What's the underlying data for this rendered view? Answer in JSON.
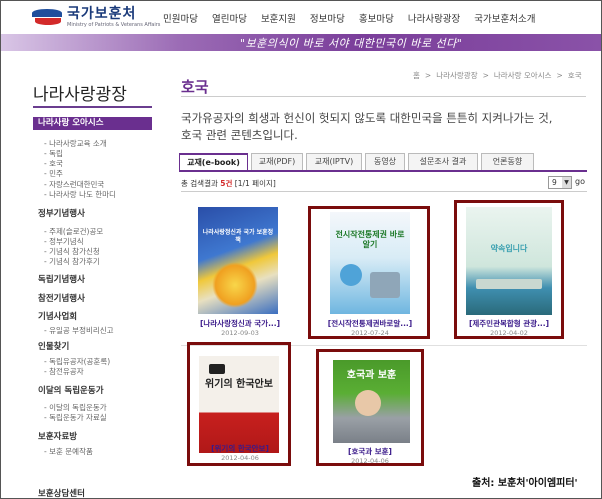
{
  "header": {
    "logo_ko": "국가보훈처",
    "logo_en": "Ministry of Patriots & Veterans Affairs",
    "nav": [
      "민원마당",
      "열린마당",
      "보훈지원",
      "정보마당",
      "홍보마당",
      "나라사랑광장",
      "국가보훈처소개"
    ],
    "slogan": "\"보훈의식이 바로 서야 대한민국이 바로 선다\""
  },
  "sidebar": {
    "title": "나라사랑광장",
    "active": "나라사랑 오아시스",
    "items": [
      {
        "label": "나라사랑교육 소개",
        "level": 2
      },
      {
        "label": "독립",
        "level": 2
      },
      {
        "label": "호국",
        "level": 2
      },
      {
        "label": "민주",
        "level": 2
      },
      {
        "label": "자랑스런대한민국",
        "level": 2
      },
      {
        "label": "나라사랑 나도 한마디",
        "level": 2
      },
      {
        "label": "정부기념행사",
        "level": 1
      },
      {
        "label": "주제(슬로건)공모",
        "level": 2
      },
      {
        "label": "정부기념식",
        "level": 2
      },
      {
        "label": "기념식 참가신청",
        "level": 2
      },
      {
        "label": "기념식 참가후기",
        "level": 2
      },
      {
        "label": "독립기념행사",
        "level": 1
      },
      {
        "label": "참전기념행사",
        "level": 1
      },
      {
        "label": "기념사업회",
        "level": 1
      },
      {
        "label": "유일공 부정비리신고",
        "level": 2
      },
      {
        "label": "인물찾기",
        "level": 1
      },
      {
        "label": "독립유공자(공훈록)",
        "level": 2
      },
      {
        "label": "참전유공자",
        "level": 2
      },
      {
        "label": "이달의 독립운동가",
        "level": 1
      },
      {
        "label": "이달의 독립운동가",
        "level": 2
      },
      {
        "label": "독립운동가 자료실",
        "level": 2
      },
      {
        "label": "보훈자료방",
        "level": 1
      },
      {
        "label": "보훈 문예작품",
        "level": 2
      },
      {
        "label": "보훈상담센터",
        "level": 1
      }
    ]
  },
  "main": {
    "title": "호국",
    "breadcrumb": [
      "홈",
      "나라사랑광장",
      "나라사랑 오아시스",
      "호국"
    ],
    "intro_line1": "국가유공자의 희생과 헌신이 헛되지 않도록 대한민국을 튼튼히 지켜나가는 것,",
    "intro_line2": "호국 관련 콘텐츠입니다.",
    "tabs": [
      "교재(e-book)",
      "교재(PDF)",
      "교재(IPTV)",
      "동영상",
      "설문조사 결과",
      "언론동향"
    ],
    "count_prefix": "총 검색결과 ",
    "count_value": "5건",
    "count_suffix": " [1/1 페이지]",
    "per_page": "9",
    "go_label": "go",
    "books": [
      {
        "caption": "[나라사랑정신과 국가...]",
        "date": "2012-09-03",
        "cover_title": "나라사랑정신과 국가 보훈정책",
        "highlighted": false
      },
      {
        "caption": "[전시작전통제권바로알...]",
        "date": "2012-07-24",
        "cover_title": "전시작전통제권 바로알기",
        "highlighted": true
      },
      {
        "caption": "[제주민관복합형 관광...]",
        "date": "2012-04-02",
        "cover_title": "약속입니다",
        "highlighted": true
      },
      {
        "caption": "[위기의 한국안보]",
        "date": "2012-04-06",
        "cover_title": "위기의 한국안보",
        "highlighted": true
      },
      {
        "caption": "[호국과 보훈]",
        "date": "2012-04-06",
        "cover_title": "호국과 보훈",
        "highlighted": true
      }
    ]
  },
  "source": "출처: 보훈처'아이엠피터'"
}
